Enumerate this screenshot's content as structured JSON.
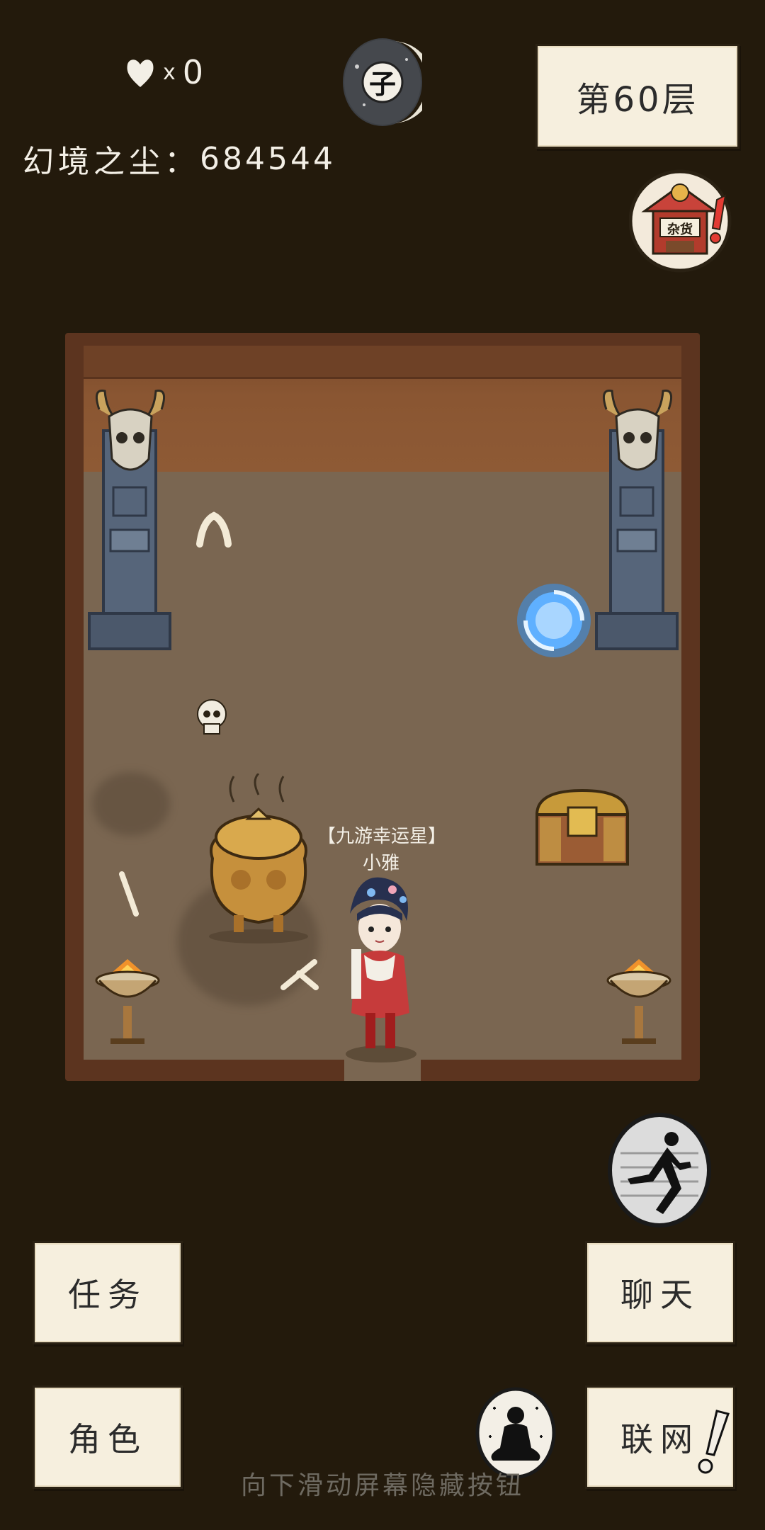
{
  "hud": {
    "lives_prefix": "x",
    "lives_count": "0",
    "dust_label": "幻境之尘：",
    "dust_value": "684544",
    "time_char": "子",
    "floor_label": "第60层",
    "shop_sign": "杂货"
  },
  "character": {
    "title": "【九游幸运星】",
    "name": "小雅"
  },
  "buttons": {
    "tasks": "任务",
    "chat": "聊天",
    "role": "角色",
    "network": "联网"
  },
  "hint": "向下滑动屏幕隐藏按钮",
  "colors": {
    "background": "#231a0c",
    "paper": "#f6efde",
    "floor": "#7a6651",
    "wall": "#8a5632"
  }
}
